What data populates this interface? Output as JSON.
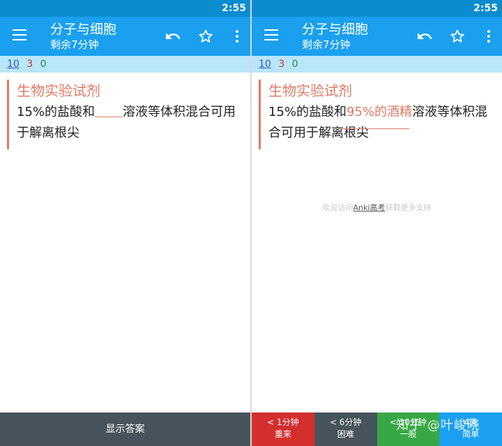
{
  "status": {
    "time": "2:55"
  },
  "deck": {
    "title": "分子与细胞",
    "subtitle": "剩余7分钟"
  },
  "counts": {
    "new": "10",
    "learn": "3",
    "review": "0"
  },
  "card": {
    "title": "生物实验试剂",
    "text_before": "15%的盐酸和",
    "answer": "95%的酒精",
    "text_after": "溶液等体积混合可用于解离根尖"
  },
  "footer_note": {
    "prefix": "欢迎访问",
    "link": "Anki高考",
    "suffix": "获取更多支持"
  },
  "show_answer_label": "显示答案",
  "ease_buttons": [
    {
      "interval": "< 1分钟",
      "label": "重来"
    },
    {
      "interval": "< 6分钟",
      "label": "困难"
    },
    {
      "interval": "< 10分钟",
      "label": "一般"
    },
    {
      "interval": "4天",
      "label": "简单"
    }
  ],
  "watermark": "知乎 @叶峻晓",
  "colors": {
    "toolbar": "#1aa0ef",
    "statusbar": "#0b8ccf",
    "accent": "#e07a62",
    "again": "#d32f2f",
    "good": "#38a846"
  }
}
